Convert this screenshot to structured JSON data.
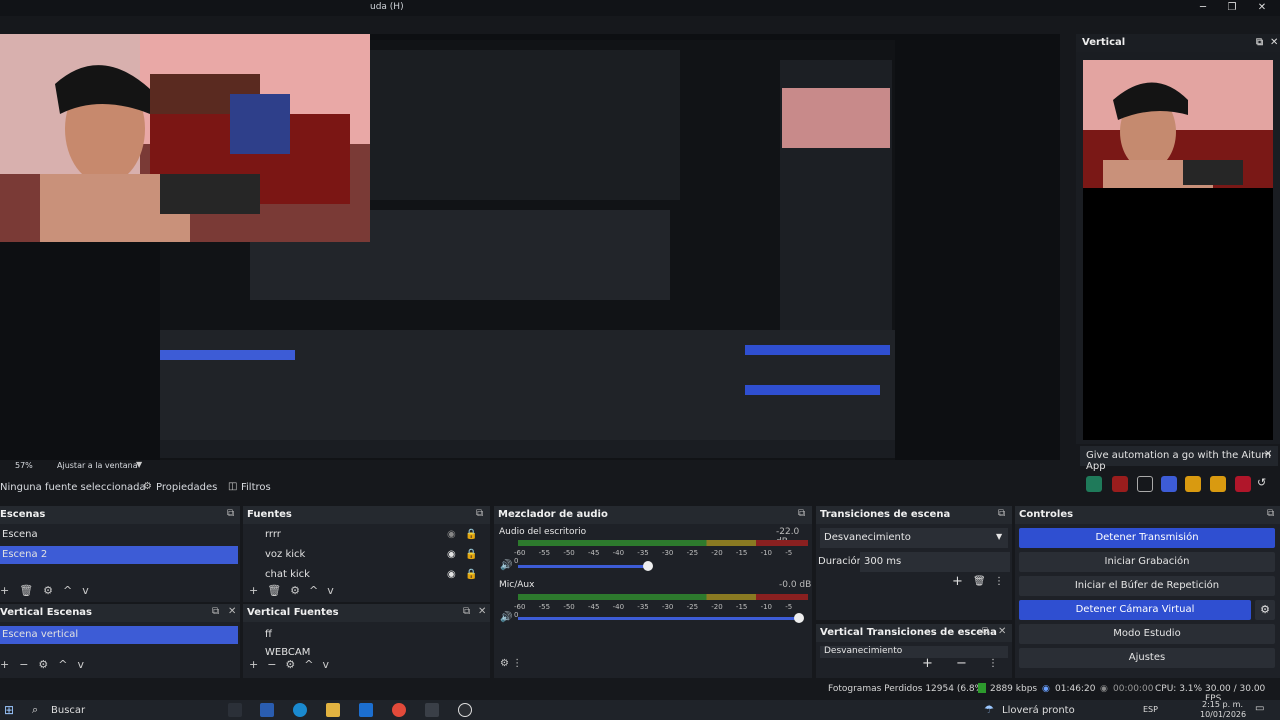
{
  "window": {
    "title_fragment": "uda (H)"
  },
  "vertical_panel": {
    "title": "Vertical",
    "notification": "Give automation a go with the Aitum App"
  },
  "preview": {
    "zoom": "57%",
    "scale_label": "Ajustar a la ventana"
  },
  "toolbar": {
    "no_source": "Ninguna fuente seleccionada",
    "properties": "Propiedades",
    "filters": "Filtros"
  },
  "scenes": {
    "title": "Escenas",
    "items": [
      "Escena",
      "Escena 2"
    ]
  },
  "sources": {
    "title": "Fuentes",
    "items": [
      "rrrr",
      "voz kick",
      "chat kick"
    ]
  },
  "vertical_scenes": {
    "title": "Vertical Escenas",
    "items": [
      "Escena vertical"
    ]
  },
  "vertical_sources": {
    "title": "Vertical Fuentes",
    "items": [
      "ff",
      "WEBCAM"
    ]
  },
  "mixer": {
    "title": "Mezclador de audio",
    "channels": [
      {
        "name": "Audio del escritorio",
        "db": "-22.0 dB",
        "level": 0.5
      },
      {
        "name": "Mic/Aux",
        "db": "-0.0 dB",
        "level": 1.0
      }
    ],
    "ticks": [
      "-60",
      "-55",
      "-50",
      "-45",
      "-40",
      "-35",
      "-30",
      "-25",
      "-20",
      "-15",
      "-10",
      "-5",
      "0"
    ]
  },
  "transitions": {
    "title": "Transiciones de escena",
    "selected": "Desvanecimiento",
    "duration_label": "Duración",
    "duration_value": "300 ms"
  },
  "vertical_transitions": {
    "title": "Vertical Transiciones de escena",
    "selected": "Desvanecimiento"
  },
  "controls": {
    "title": "Controles",
    "stop_stream": "Detener Transmisión",
    "start_recording": "Iniciar Grabación",
    "replay_buffer": "Iniciar el Búfer de Repetición",
    "stop_vcam": "Detener Cámara Virtual",
    "studio_mode": "Modo Estudio",
    "settings": "Ajustes"
  },
  "status": {
    "dropped": "Fotogramas Perdidos 12954 (6.8%)",
    "bitrate": "2889 kbps",
    "stream_time": "01:46:20",
    "rec_time": "00:00:00",
    "cpu": "CPU: 3.1%",
    "fps": "30.00 / 30.00 FPS"
  },
  "taskbar": {
    "search": "Buscar",
    "weather": "Lloverá pronto",
    "lang": "ESP",
    "time": "2:15 p. m.",
    "date": "10/01/2026"
  },
  "colors": {
    "accent": "#3d5cd6",
    "panel": "#1e2127",
    "header": "#25292f"
  }
}
